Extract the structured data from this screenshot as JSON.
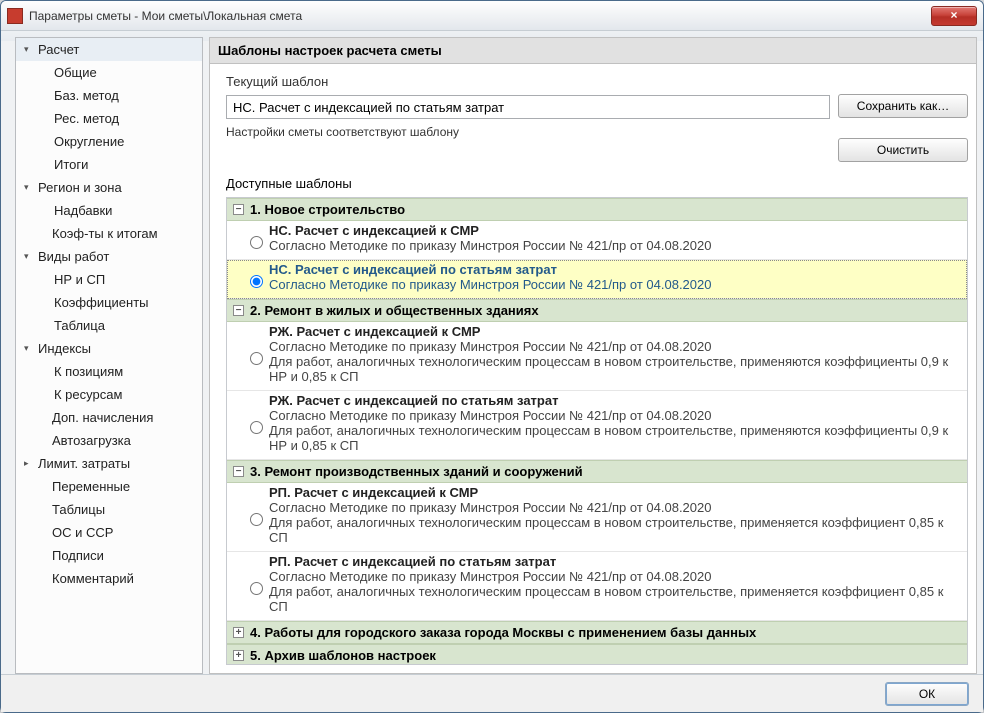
{
  "window": {
    "title": "Параметры сметы - Мои сметы\\Локальная смета"
  },
  "close_label": "×",
  "sidebar": {
    "items": [
      {
        "label": "Расчет",
        "kind": "parent",
        "caret": "▾",
        "selected": true
      },
      {
        "label": "Общие",
        "kind": "child"
      },
      {
        "label": "Баз. метод",
        "kind": "child"
      },
      {
        "label": "Рес. метод",
        "kind": "child"
      },
      {
        "label": "Округление",
        "kind": "child"
      },
      {
        "label": "Итоги",
        "kind": "child"
      },
      {
        "label": "Регион и зона",
        "kind": "parent",
        "caret": "▾"
      },
      {
        "label": "Надбавки",
        "kind": "child"
      },
      {
        "label": "Коэф-ты к итогам",
        "kind": "link"
      },
      {
        "label": "Виды работ",
        "kind": "parent",
        "caret": "▾"
      },
      {
        "label": "НР и СП",
        "kind": "child"
      },
      {
        "label": "Коэффициенты",
        "kind": "child"
      },
      {
        "label": "Таблица",
        "kind": "child"
      },
      {
        "label": "Индексы",
        "kind": "parent",
        "caret": "▾"
      },
      {
        "label": "К позициям",
        "kind": "child"
      },
      {
        "label": "К ресурсам",
        "kind": "child"
      },
      {
        "label": "Доп. начисления",
        "kind": "link"
      },
      {
        "label": "Автозагрузка",
        "kind": "link"
      },
      {
        "label": "Лимит. затраты",
        "kind": "parent",
        "caret": "▸"
      },
      {
        "label": "Переменные",
        "kind": "link"
      },
      {
        "label": "Таблицы",
        "kind": "link"
      },
      {
        "label": "ОС и ССР",
        "kind": "link"
      },
      {
        "label": "Подписи",
        "kind": "link"
      },
      {
        "label": "Комментарий",
        "kind": "link"
      }
    ]
  },
  "panel": {
    "header": "Шаблоны настроек расчета сметы",
    "current_label": "Текущий шаблон",
    "current_value": "НС. Расчет с индексацией по статьям затрат",
    "status": "Настройки сметы соответствуют шаблону",
    "available_label": "Доступные шаблоны",
    "save_as": "Сохранить как…",
    "clear": "Очистить"
  },
  "groups": [
    {
      "num": "1.",
      "title": "Новое строительство",
      "state": "-",
      "options": [
        {
          "title": "НС. Расчет с индексацией к СМР",
          "desc": "Согласно Методике по приказу Минстроя России № 421/пр от 04.08.2020",
          "selected": false
        },
        {
          "title": "НС. Расчет с индексацией по статьям затрат",
          "desc": "Согласно Методике по приказу Минстроя России № 421/пр от 04.08.2020",
          "selected": true
        }
      ]
    },
    {
      "num": "2.",
      "title": "Ремонт в жилых и общественных зданиях",
      "state": "-",
      "options": [
        {
          "title": "РЖ. Расчет с индексацией к СМР",
          "desc": "Согласно Методике по приказу Минстроя России № 421/пр от 04.08.2020\nДля работ, аналогичных технологическим процессам в новом строительстве, применяются коэффициенты 0,9 к НР и 0,85 к СП",
          "selected": false
        },
        {
          "title": "РЖ. Расчет с индексацией по статьям затрат",
          "desc": "Согласно Методике по приказу Минстроя России № 421/пр от 04.08.2020\nДля работ, аналогичных технологическим процессам в новом строительстве, применяются коэффициенты 0,9 к НР и 0,85 к СП",
          "selected": false
        }
      ]
    },
    {
      "num": "3.",
      "title": "Ремонт производственных зданий и сооружений",
      "state": "-",
      "options": [
        {
          "title": "РП. Расчет с индексацией к СМР",
          "desc": "Согласно Методике по приказу Минстроя России № 421/пр от 04.08.2020\nДля работ, аналогичных технологическим процессам в новом строительстве, применяется коэффициент 0,85 к СП",
          "selected": false
        },
        {
          "title": "РП. Расчет с индексацией по статьям затрат",
          "desc": "Согласно Методике по приказу Минстроя России № 421/пр от 04.08.2020\nДля работ, аналогичных технологическим процессам в новом строительстве, применяется коэффициент 0,85 к СП",
          "selected": false
        }
      ]
    },
    {
      "num": "4.",
      "title": "Работы для городского заказа города Москвы с применением базы данных",
      "state": "+",
      "options": []
    },
    {
      "num": "5.",
      "title": "Архив шаблонов настроек",
      "state": "+",
      "options": []
    }
  ],
  "footer": {
    "ok": "ОК"
  }
}
